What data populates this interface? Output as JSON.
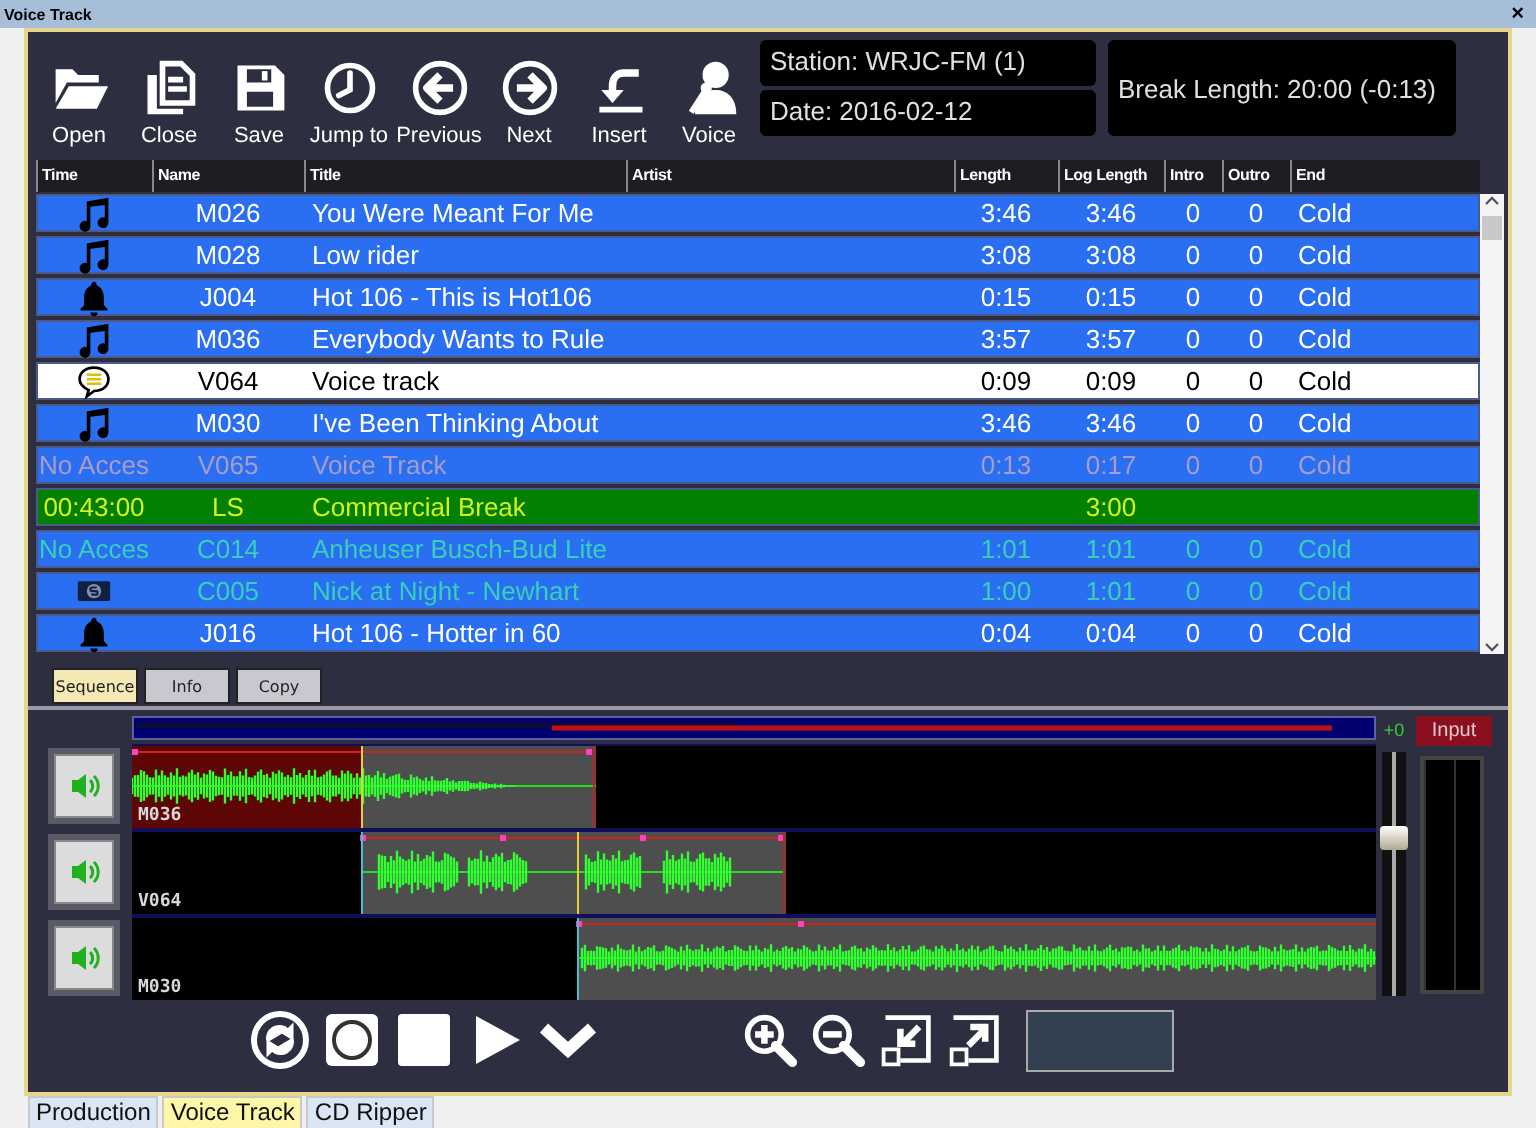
{
  "window": {
    "title": "Voice Track",
    "close": "×"
  },
  "toolbar": [
    {
      "label": "Open",
      "kind": "folder"
    },
    {
      "label": "Close",
      "kind": "documents"
    },
    {
      "label": "Save",
      "kind": "floppy"
    },
    {
      "label": "Jump to",
      "kind": "clock"
    },
    {
      "label": "Previous",
      "kind": "left"
    },
    {
      "label": "Next",
      "kind": "right"
    },
    {
      "label": "Insert",
      "kind": "insert"
    },
    {
      "label": "Voice",
      "kind": "voice"
    }
  ],
  "info": {
    "station": "Station: WRJC-FM (1)",
    "date": "Date: 2016-02-12",
    "break_length": "Break Length: 20:00 (-0:13)"
  },
  "table": {
    "columns": [
      "Time",
      "Name",
      "Title",
      "Artist",
      "Length",
      "Log Length",
      "Intro",
      "Outro",
      "End"
    ],
    "rows": [
      {
        "kind": "music",
        "name": "M026",
        "title": "You Were Meant For Me",
        "length": "3:46",
        "log_length": "3:46",
        "intro": "0",
        "outro": "0",
        "end": "Cold",
        "color": "#ffffff",
        "selected": false
      },
      {
        "kind": "music",
        "name": "M028",
        "title": "Low rider",
        "length": "3:08",
        "log_length": "3:08",
        "intro": "0",
        "outro": "0",
        "end": "Cold",
        "color": "#ffffff",
        "selected": false
      },
      {
        "kind": "bell",
        "name": "J004",
        "title": "Hot 106 - This is Hot106",
        "length": "0:15",
        "log_length": "0:15",
        "intro": "0",
        "outro": "0",
        "end": "Cold",
        "color": "#ffffff",
        "selected": false
      },
      {
        "kind": "music",
        "name": "M036",
        "title": "Everybody Wants to Rule",
        "length": "3:57",
        "log_length": "3:57",
        "intro": "0",
        "outro": "0",
        "end": "Cold",
        "color": "#ffffff",
        "selected": false
      },
      {
        "kind": "speech",
        "name": "V064",
        "title": "Voice track",
        "length": "0:09",
        "log_length": "0:09",
        "intro": "0",
        "outro": "0",
        "end": "Cold",
        "color": "#000000",
        "selected": true
      },
      {
        "kind": "music",
        "name": "M030",
        "title": "I've Been Thinking About",
        "length": "3:46",
        "log_length": "3:46",
        "intro": "0",
        "outro": "0",
        "end": "Cold",
        "color": "#ffffff",
        "selected": false
      },
      {
        "kind": "unavailable",
        "time": "No Acces",
        "name": "V065",
        "title": "Voice Track",
        "length": "0:13",
        "log_length": "0:17",
        "intro": "0",
        "outro": "0",
        "end": "Cold",
        "color": "#a89cc8",
        "selected": false
      },
      {
        "kind": "break",
        "time": "00:43:00",
        "name": "LS",
        "title": "Commercial Break",
        "log_length": "3:00",
        "color": "#d4f020",
        "selected": false
      },
      {
        "kind": "unavailable",
        "time": "No Acces",
        "name": "C014",
        "title": "Anheuser Busch-Bud Lite",
        "length": "1:01",
        "log_length": "1:01",
        "intro": "0",
        "outro": "0",
        "end": "Cold",
        "color": "#38d0b8",
        "selected": false
      },
      {
        "kind": "cash",
        "name": "C005",
        "title": "Nick at Night - Newhart",
        "length": "1:00",
        "log_length": "1:01",
        "intro": "0",
        "outro": "0",
        "end": "Cold",
        "color": "#38d0b8",
        "selected": false
      },
      {
        "kind": "bell",
        "name": "J016",
        "title": "Hot 106 - Hotter in 60",
        "length": "0:04",
        "log_length": "0:04",
        "intro": "0",
        "outro": "0",
        "end": "Cold",
        "color": "#ffffff",
        "selected": false
      }
    ]
  },
  "editor": {
    "tabs": [
      {
        "label": "Sequence",
        "selected": true
      },
      {
        "label": "Info",
        "selected": false
      },
      {
        "label": "Copy",
        "selected": false
      }
    ],
    "gain": "+0",
    "input_button": "Input",
    "fader": {
      "level": 0.66
    },
    "tracks": [
      {
        "label": "M036"
      },
      {
        "label": "V064"
      },
      {
        "label": "M030"
      }
    ],
    "transport": [
      {
        "kind": "loop"
      },
      {
        "kind": "record"
      },
      {
        "kind": "stop"
      },
      {
        "kind": "play"
      },
      {
        "kind": "chevron"
      }
    ],
    "zoom": [
      {
        "kind": "zoom_in"
      },
      {
        "kind": "zoom_out"
      },
      {
        "kind": "shrink"
      },
      {
        "kind": "expand"
      }
    ]
  },
  "bottom_tabs": [
    {
      "label": "Production",
      "selected": false
    },
    {
      "label": "Voice Track",
      "selected": true
    },
    {
      "label": "CD Ripper",
      "selected": false
    }
  ]
}
